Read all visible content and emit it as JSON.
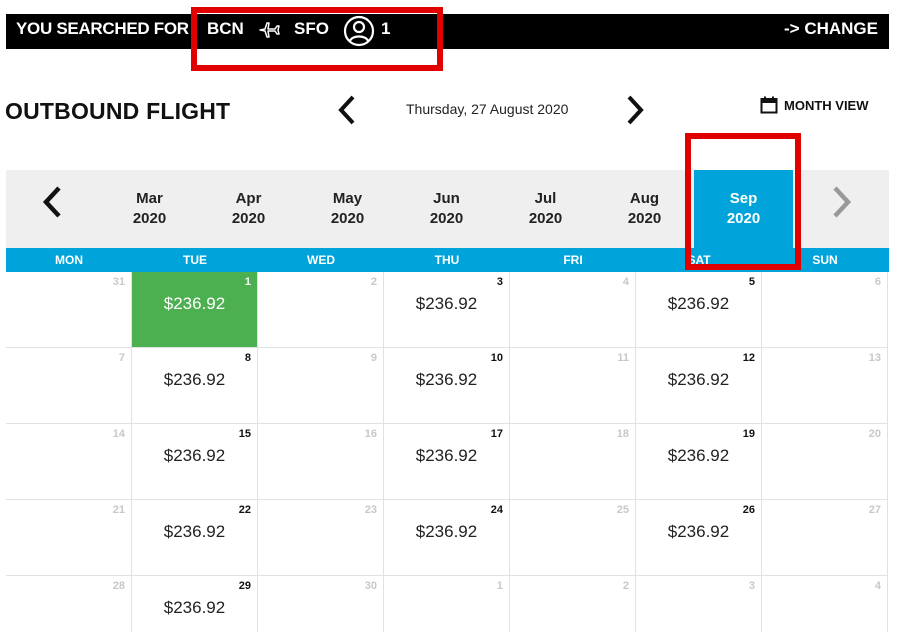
{
  "search": {
    "label": "YOU SEARCHED FOR",
    "origin": "BCN",
    "destination": "SFO",
    "passengers": "1",
    "change_label": "-> CHANGE"
  },
  "outbound": {
    "title": "OUTBOUND FLIGHT",
    "date": "Thursday, 27 August 2020",
    "month_view_label": "MONTH VIEW"
  },
  "months": [
    {
      "month": "Mar",
      "year": "2020"
    },
    {
      "month": "Apr",
      "year": "2020"
    },
    {
      "month": "May",
      "year": "2020"
    },
    {
      "month": "Jun",
      "year": "2020"
    },
    {
      "month": "Jul",
      "year": "2020"
    },
    {
      "month": "Aug",
      "year": "2020"
    },
    {
      "month": "Sep",
      "year": "2020",
      "active": true
    }
  ],
  "weekdays": [
    "MON",
    "TUE",
    "WED",
    "THU",
    "FRI",
    "SAT",
    "SUN"
  ],
  "calendar": {
    "weeks": [
      [
        {
          "day": "31"
        },
        {
          "day": "1",
          "price": "$236.92",
          "selected": true
        },
        {
          "day": "2"
        },
        {
          "day": "3",
          "price": "$236.92"
        },
        {
          "day": "4"
        },
        {
          "day": "5",
          "price": "$236.92"
        },
        {
          "day": "6"
        }
      ],
      [
        {
          "day": "7"
        },
        {
          "day": "8",
          "price": "$236.92"
        },
        {
          "day": "9"
        },
        {
          "day": "10",
          "price": "$236.92"
        },
        {
          "day": "11"
        },
        {
          "day": "12",
          "price": "$236.92"
        },
        {
          "day": "13"
        }
      ],
      [
        {
          "day": "14"
        },
        {
          "day": "15",
          "price": "$236.92"
        },
        {
          "day": "16"
        },
        {
          "day": "17",
          "price": "$236.92"
        },
        {
          "day": "18"
        },
        {
          "day": "19",
          "price": "$236.92"
        },
        {
          "day": "20"
        }
      ],
      [
        {
          "day": "21"
        },
        {
          "day": "22",
          "price": "$236.92"
        },
        {
          "day": "23"
        },
        {
          "day": "24",
          "price": "$236.92"
        },
        {
          "day": "25"
        },
        {
          "day": "26",
          "price": "$236.92"
        },
        {
          "day": "27"
        }
      ],
      [
        {
          "day": "28"
        },
        {
          "day": "29",
          "price": "$236.92"
        },
        {
          "day": "30"
        },
        {
          "day": "1"
        },
        {
          "day": "2"
        },
        {
          "day": "3"
        },
        {
          "day": "4"
        }
      ]
    ]
  },
  "icons": {
    "plane": "plane-icon",
    "passenger": "user-circle-icon",
    "calendar": "calendar-icon",
    "prev": "chevron-left-icon",
    "next": "chevron-right-icon"
  },
  "colors": {
    "accent": "#00a4db",
    "selected": "#4caf50",
    "highlight": "#e10000",
    "bar": "#000000"
  }
}
